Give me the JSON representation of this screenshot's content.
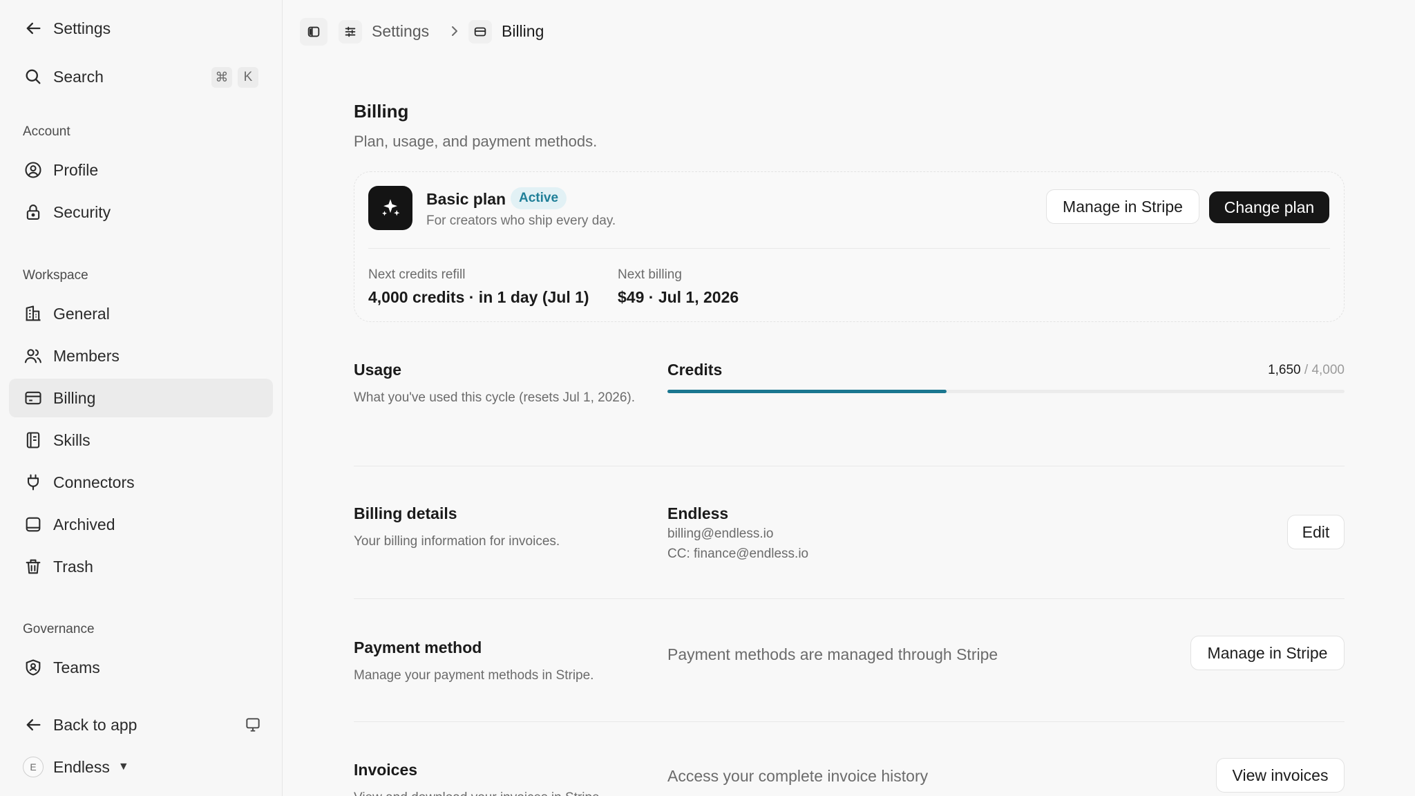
{
  "sidebar": {
    "back_label": "Settings",
    "search_label": "Search",
    "search_shortcut": [
      "⌘",
      "K"
    ],
    "groups": {
      "account": "Account",
      "workspace": "Workspace",
      "governance": "Governance"
    },
    "items": {
      "profile": "Profile",
      "security": "Security",
      "general": "General",
      "members": "Members",
      "billing": "Billing",
      "skills": "Skills",
      "connectors": "Connectors",
      "archived": "Archived",
      "trash": "Trash",
      "teams": "Teams"
    },
    "active_item": "billing",
    "back_to_app": "Back to app",
    "workspace_name": "Endless",
    "workspace_initial": "E"
  },
  "breadcrumb": {
    "parent": "Settings",
    "current": "Billing"
  },
  "page": {
    "title": "Billing",
    "subtitle": "Plan, usage, and payment methods."
  },
  "plan": {
    "name": "Basic plan",
    "status": "Active",
    "description": "For creators who ship every day.",
    "manage_label": "Manage in Stripe",
    "change_label": "Change plan",
    "next_refill_label": "Next credits refill",
    "next_refill_value": "4,000 credits · in 1 day (Jul 1)",
    "next_billing_label": "Next billing",
    "next_billing_value": "$49 · Jul 1, 2026"
  },
  "usage": {
    "title": "Usage",
    "description": "What you've used this cycle (resets Jul 1, 2026).",
    "credits_label": "Credits",
    "used": "1,650",
    "separator": "/",
    "total": "4,000",
    "fraction": 0.4125
  },
  "billing_details": {
    "title": "Billing details",
    "description": "Your billing information for invoices.",
    "company": "Endless",
    "email": "billing@endless.io",
    "cc": "CC: finance@endless.io",
    "edit_label": "Edit"
  },
  "payment_method": {
    "title": "Payment method",
    "description": "Manage your payment methods in Stripe.",
    "info": "Payment methods are managed through Stripe",
    "button_label": "Manage in Stripe"
  },
  "invoices": {
    "title": "Invoices",
    "description": "View and download your invoices in Stripe.",
    "info": "Access your complete invoice history",
    "button_label": "View invoices"
  },
  "colors": {
    "accent": "#1b7790",
    "badge_bg": "#e2f1f5",
    "badge_text": "#1f7f98",
    "primary_button": "#161616"
  },
  "icons": {
    "back": "arrow-left-icon",
    "search": "search-icon",
    "profile": "user-circle-icon",
    "security": "lock-icon",
    "general": "building-icon",
    "members": "users-icon",
    "billing": "credit-card-icon",
    "skills": "book-icon",
    "connectors": "plug-icon",
    "archived": "archive-box-icon",
    "trash": "trash-icon",
    "teams": "shield-user-icon",
    "plan_logo": "sparkles-icon"
  }
}
